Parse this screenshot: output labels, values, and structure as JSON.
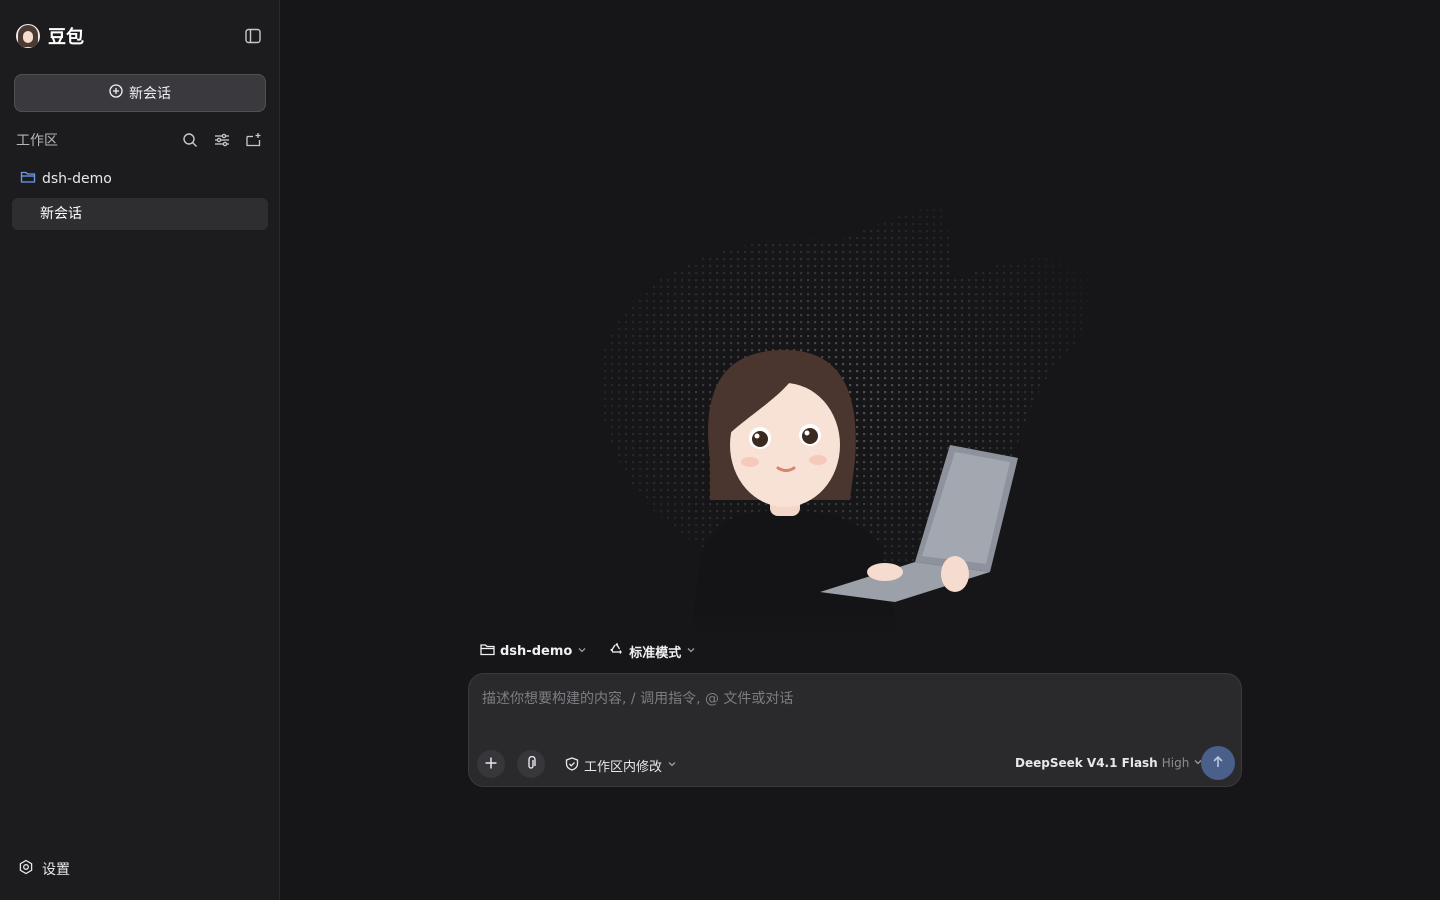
{
  "brand": {
    "name": "豆包"
  },
  "sidebar": {
    "new_chat_label": "新会话",
    "workspace_title": "工作区",
    "folder_name": "dsh-demo",
    "chat_item_label": "新会话",
    "settings_label": "设置"
  },
  "context": {
    "project": "dsh-demo",
    "mode": "标准模式"
  },
  "composer": {
    "placeholder": "描述你想要构建的内容, / 调用指令, @ 文件或对话",
    "value": "",
    "permission": "工作区内修改",
    "model_name": "DeepSeek V4.1 Flash",
    "model_effort": "High"
  },
  "colors": {
    "background": "#161618",
    "sidebar": "#1c1c1e",
    "composer": "#2a2a2d",
    "send_button": "#4a5f8a",
    "folder_accent": "#6f9cf0"
  },
  "icons": {
    "collapse": "sidebar-toggle-icon",
    "new_chat": "plus-circle-icon",
    "search": "search-icon",
    "filter": "sliders-icon",
    "new_folder": "folder-plus-icon",
    "folder": "folder-icon",
    "settings": "gear-icon",
    "mode": "recycle-icon",
    "add": "plus-icon",
    "attach": "paperclip-icon",
    "permission": "shield-icon",
    "send": "arrow-up-icon"
  }
}
